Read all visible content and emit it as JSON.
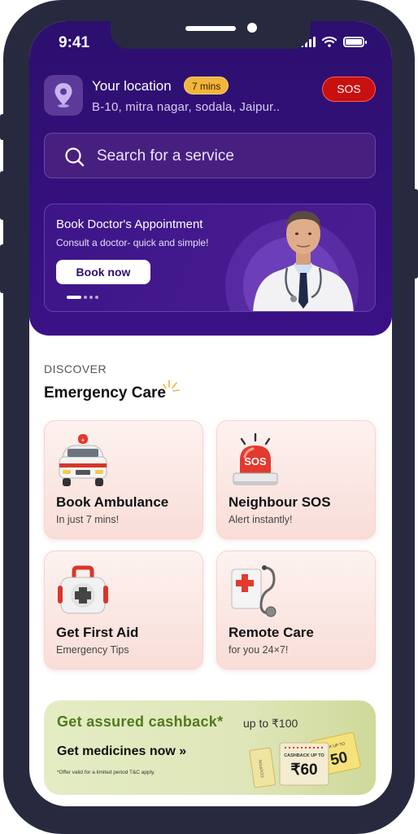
{
  "status_bar": {
    "time": "9:41"
  },
  "location": {
    "title": "Your location",
    "eta": "7 mins",
    "address": "B-10, mitra nagar, sodala, Jaipur..",
    "sos_label": "SOS"
  },
  "search": {
    "placeholder": "Search for a service"
  },
  "banner": {
    "title": "Book Doctor's Appointment",
    "subtitle": "Consult a doctor- quick and simple!",
    "button_label": "Book now",
    "active_slide": 1,
    "slide_count": 4
  },
  "discover": {
    "label": "DISCOVER",
    "title": "Emergency Care"
  },
  "services": [
    {
      "title": "Book Ambulance",
      "subtitle": "In just 7 mins!",
      "icon": "ambulance-icon"
    },
    {
      "title": "Neighbour SOS",
      "subtitle": "Alert instantly!",
      "icon": "sos-siren-icon"
    },
    {
      "title": "Get First Aid",
      "subtitle": "Emergency Tips",
      "icon": "first-aid-kit-icon"
    },
    {
      "title": "Remote Care",
      "subtitle": "for you 24×7!",
      "icon": "stethoscope-icon"
    }
  ],
  "promo": {
    "line1": "Get assured  cashback*",
    "upto": "up to ₹100",
    "line2": "Get medicines now »",
    "fine_print": "*Offer valid for a limited period T&C apply.",
    "coupon_front_top": "CASHBACK UP TO",
    "coupon_front_amount": "₹60",
    "coupon_back_top": "BACK UP TO",
    "coupon_back_amount": "50",
    "coupon_side_label": "COUPON"
  },
  "colors": {
    "hero_bg": "#2c0f6e",
    "sos_red": "#c8100f",
    "eta_amber": "#f1b53a",
    "promo_green": "#4f7b1b",
    "card_bg": "#fbe6e2"
  }
}
